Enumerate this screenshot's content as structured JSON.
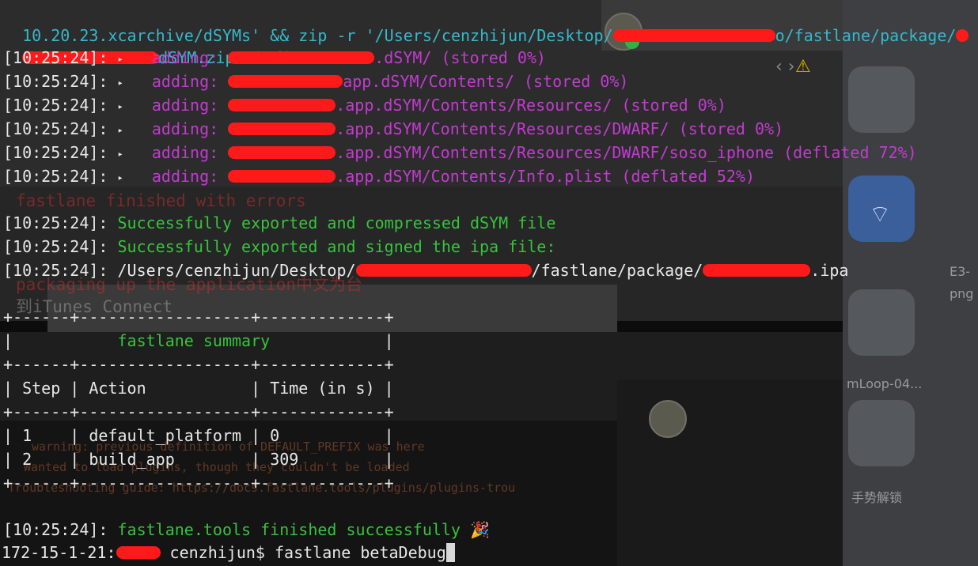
{
  "background": {
    "side_labels": [
      "E3-",
      "png",
      "mLoop-04...",
      "手势解锁"
    ],
    "ghost_lines": [
      "fastlane finished with errors",
      "packaging up the application中文为台",
      "到iTunes Connect"
    ],
    "ghost_small": [
      "warning: previous definition of DEFAULT_PREFIX was here",
      "Wanted to load plugins, though they couldn't be loaded",
      "Troubleshooting guide: https://docs.fastlane.tools/plugins/plugins-trou"
    ]
  },
  "terminal": {
    "line0": "10.20.23.xcarchive/dSYMs' && zip -r '/Users/cenzhijun/Desktop/",
    "line0_mid": "o/fastlane/package/",
    "line1_tail": "dSYM.zip' *.dSYM",
    "timestamp": "[10:25:24]:",
    "adding_label": "adding:",
    "adding_items": [
      ".dSYM/ (stored 0%)",
      "app.dSYM/Contents/ (stored 0%)",
      ".app.dSYM/Contents/Resources/ (stored 0%)",
      ".app.dSYM/Contents/Resources/DWARF/ (stored 0%)",
      ".app.dSYM/Contents/Resources/DWARF/soso_iphone (deflated 72%)",
      ".app.dSYM/Contents/Info.plist (deflated 52%)"
    ],
    "success_dsym": "Successfully exported and compressed dSYM file",
    "success_ipa": "Successfully exported and signed the ipa file:",
    "path_start": "/Users/cenzhijun/Desktop/",
    "path_mid": "/fastlane/package/",
    "path_end": ".ipa",
    "summary": {
      "border": "+------+------------------+-------------+",
      "title": "fastlane summary",
      "headers": [
        "Step",
        "Action",
        "Time (in s)"
      ],
      "rows": [
        {
          "step": "1",
          "action": "default_platform",
          "time": "0"
        },
        {
          "step": "2",
          "action": "build_app",
          "time": "309"
        }
      ]
    },
    "finished": "fastlane.tools finished successfully",
    "prompt_host": "172-15-1-21:",
    "prompt_user": "cenzhijun$",
    "command": "fastlane betaDebug"
  }
}
